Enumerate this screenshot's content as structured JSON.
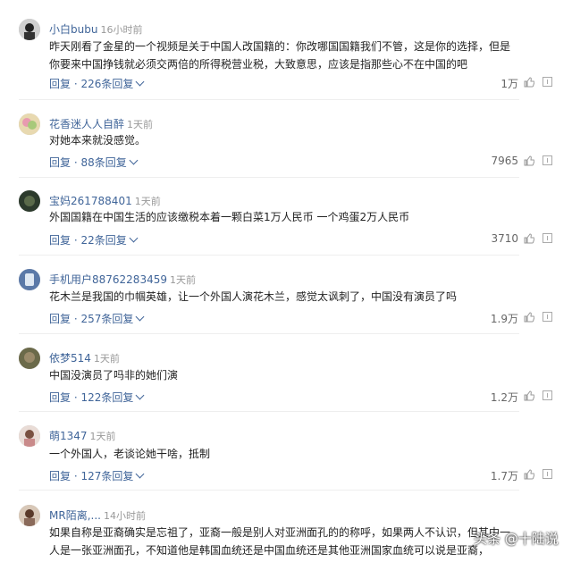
{
  "comments": [
    {
      "user": "小白bubu",
      "time": "16小时前",
      "text": "昨天刚看了金星的一个视频是关于中国人改国籍的：你改哪国国籍我们不管，这是你的选择，但是你要来中国挣钱就必须交两倍的所得税营业税，大致意思，应该是指那些心不在中国的吧",
      "reply": "回复 · 226条回复",
      "likes": "1万"
    },
    {
      "user": "花香迷人人自醉",
      "time": "1天前",
      "text": "对她本来就没感觉。",
      "reply": "回复 · 88条回复",
      "likes": "7965"
    },
    {
      "user": "宝妈261788401",
      "time": "1天前",
      "text": "外国国籍在中国生活的应该缴税本着一颗白菜1万人民币 一个鸡蛋2万人民币",
      "reply": "回复 · 22条回复",
      "likes": "3710"
    },
    {
      "user": "手机用户88762283459",
      "time": "1天前",
      "text": "花木兰是我国的巾帼英雄，让一个外国人演花木兰，感觉太讽刺了，中国没有演员了吗",
      "reply": "回复 · 257条回复",
      "likes": "1.9万"
    },
    {
      "user": "依梦514",
      "time": "1天前",
      "text": "中国没演员了吗非的她们演",
      "reply": "回复 · 122条回复",
      "likes": "1.2万"
    },
    {
      "user": "萌1347",
      "time": "1天前",
      "text": "一个外国人，老谈论她干啥，抵制",
      "reply": "回复 · 127条回复",
      "likes": "1.7万"
    },
    {
      "user": "MR陌离,...",
      "time": "14小时前",
      "text": "如果自称是亚裔确实是忘祖了，亚裔一般是别人对亚洲面孔的的称呼，如果两人不认识，但其中一人是一张亚洲面孔，不知道他是韩国血统还是中国血统还是其他亚洲国家血统可以说是亚裔，",
      "reply": "",
      "likes": ""
    }
  ],
  "watermark": "头条 @十陆说",
  "colors": {
    "link": "#406599",
    "time": "#999999",
    "text": "#222222"
  },
  "icons": {
    "like": "thumb-up-icon",
    "report": "report-icon"
  }
}
